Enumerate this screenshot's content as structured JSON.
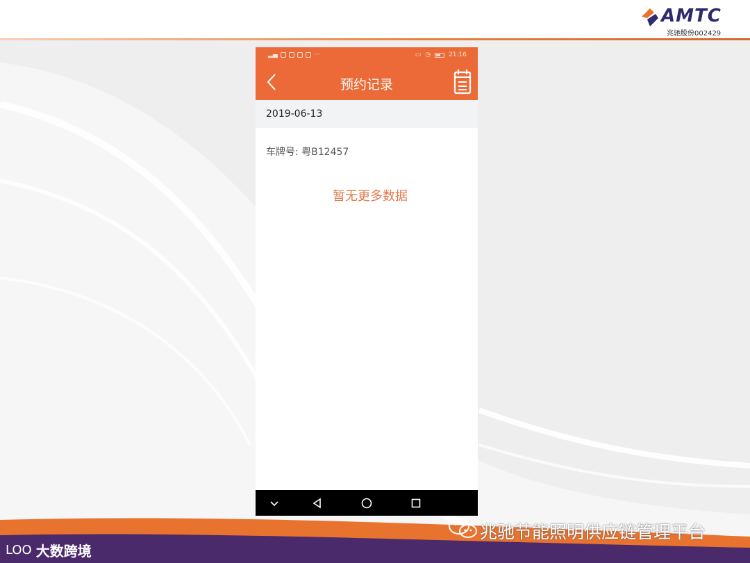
{
  "header": {
    "logo_text": "AMTC",
    "logo_sub": "兆驰股份002429"
  },
  "phone": {
    "status_bar": {
      "time": "21:16"
    },
    "title": "预约记录",
    "date": "2019-06-13",
    "plate_label": "车牌号:",
    "plate_value": "粤B12457",
    "empty_message": "暂无更多数据",
    "icons": {
      "back": "chevron-left-icon",
      "calendar": "calendar-list-icon",
      "nav_back": "triangle-back-icon",
      "nav_home": "circle-home-icon",
      "nav_recent": "square-recent-icon",
      "nav_hide": "chevron-down-icon"
    }
  },
  "footer": {
    "platform_name": "兆驰节能照明供应链管理平台",
    "brand_mark": "LOO",
    "brand_name": "大数跨境"
  },
  "colors": {
    "accent": "#ec6a37",
    "empty_text": "#e07a4c",
    "footer_purple": "#4a2a6a",
    "footer_orange": "#e8732f"
  }
}
